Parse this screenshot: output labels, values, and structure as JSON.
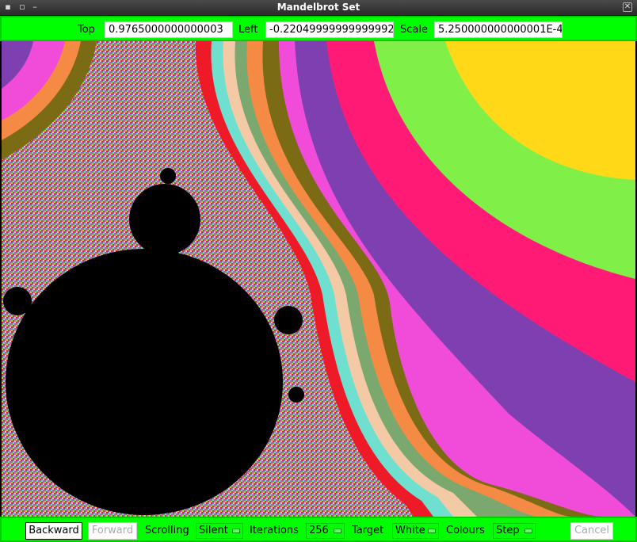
{
  "window": {
    "title": "Mandelbrot Set",
    "menu_icon": "menu-icon",
    "max_icon": "square-icon",
    "min_icon": "minimize-icon",
    "close_icon": "close-icon"
  },
  "top": {
    "top_label": "Top",
    "top_value": "0.9765000000000003",
    "left_label": "Left",
    "left_value": "-0.22049999999999992",
    "scale_label": "Scale",
    "scale_value": "5.250000000000001E-4"
  },
  "bottom": {
    "backward_label": "Backward",
    "forward_label": "Forward",
    "scrolling_label": "Scrolling",
    "scrolling_value": "Silent",
    "iterations_label": "Iterations",
    "iterations_value": "256",
    "target_label": "Target",
    "target_value": "White",
    "colours_label": "Colours",
    "colours_value": "Step",
    "cancel_label": "Cancel"
  },
  "colors": {
    "toolbar": "#00ff00",
    "bands": [
      "#7b6b14",
      "#f58a44",
      "#7aa86e",
      "#f4c9a6",
      "#6fe0d0",
      "#ef1a28",
      "#d0145e",
      "#9c3ca8",
      "#f04bd9",
      "#7e40b0",
      "#ff1a75",
      "#80f048",
      "#ffd817"
    ]
  }
}
